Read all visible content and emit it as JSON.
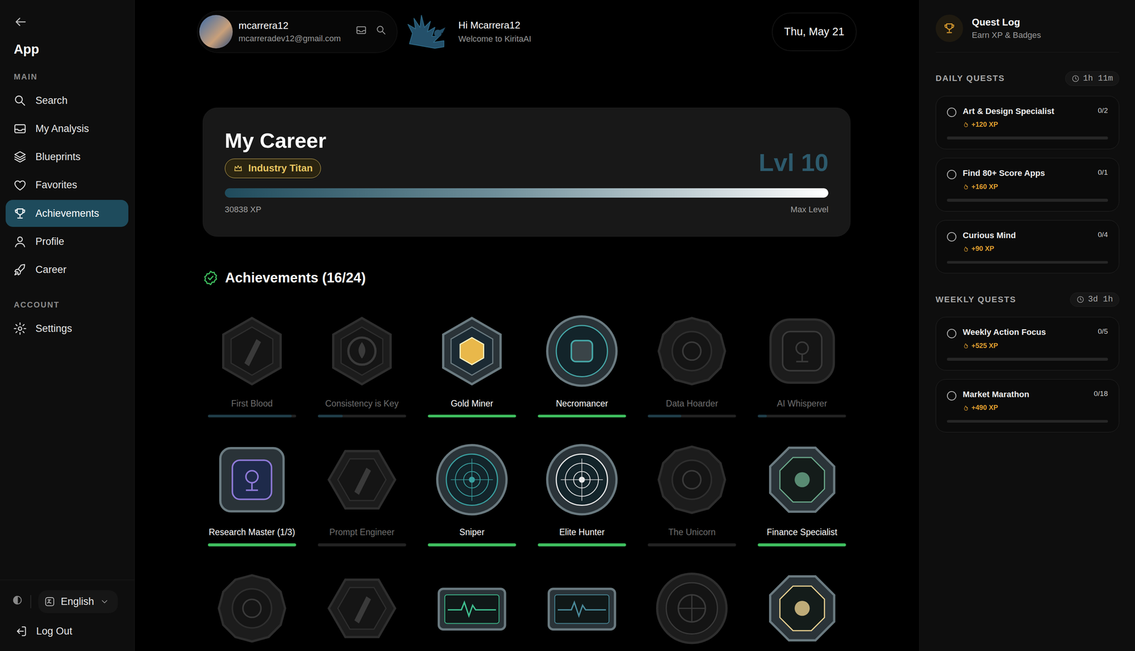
{
  "sidebar": {
    "title": "App",
    "sections": [
      {
        "heading": "MAIN",
        "items": [
          {
            "label": "Search",
            "selected": false
          },
          {
            "label": "My Analysis",
            "selected": false
          },
          {
            "label": "Blueprints",
            "selected": false
          },
          {
            "label": "Favorites",
            "selected": false
          },
          {
            "label": "Achievements",
            "selected": true
          },
          {
            "label": "Profile",
            "selected": false
          },
          {
            "label": "Career",
            "selected": false
          }
        ]
      },
      {
        "heading": "ACCOUNT",
        "items": [
          {
            "label": "Settings",
            "selected": false
          }
        ]
      }
    ],
    "language": "English",
    "logout": "Log Out"
  },
  "header": {
    "user": {
      "name": "mcarrera12",
      "email": "mcarreradev12@gmail.com"
    },
    "greeting": "Hi Mcarrera12",
    "welcome": "Welcome to KiritaAI",
    "date": "Thu, May 21"
  },
  "career": {
    "title": "My Career",
    "rank": "Industry Titan",
    "level_label": "Lvl 10",
    "level": 1,
    "xp": "30838 XP",
    "status": "Max Level"
  },
  "achievements": {
    "title": "Achievements (16/24)",
    "items": [
      {
        "name": "First Blood",
        "unlocked": false,
        "level": 0.95
      },
      {
        "name": "Consistency is Key",
        "unlocked": false,
        "level": 0.28
      },
      {
        "name": "Gold Miner",
        "unlocked": true,
        "level": 1
      },
      {
        "name": "Necromancer",
        "unlocked": true,
        "level": 1
      },
      {
        "name": "Data Hoarder",
        "unlocked": false,
        "level": 0.38
      },
      {
        "name": "AI Whisperer",
        "unlocked": false,
        "level": 0.1
      },
      {
        "name": "Research Master (1/3)",
        "unlocked": true,
        "level": 1
      },
      {
        "name": "Prompt Engineer",
        "unlocked": false,
        "level": 0
      },
      {
        "name": "Sniper",
        "unlocked": true,
        "level": 1
      },
      {
        "name": "Elite Hunter",
        "unlocked": true,
        "level": 1
      },
      {
        "name": "The Unicorn",
        "unlocked": false,
        "level": 0
      },
      {
        "name": "Finance Specialist",
        "unlocked": true,
        "level": 1
      },
      {
        "unlocked": false
      },
      {
        "unlocked": false
      },
      {
        "unlocked": true
      },
      {
        "unlocked": true
      },
      {
        "unlocked": false
      },
      {
        "unlocked": true
      }
    ]
  },
  "quest_log": {
    "title": "Quest Log",
    "subtitle": "Earn XP & Badges",
    "groups": [
      {
        "heading": "DAILY QUESTS",
        "timer": "1h 11m",
        "quests": [
          {
            "title": "Art & Design Specialist",
            "xp": "+120 XP",
            "progress": "0/2",
            "done": false,
            "level": 0
          },
          {
            "title": "Find 80+ Score Apps",
            "xp": "+160 XP",
            "progress": "0/1",
            "done": false,
            "level": 0
          },
          {
            "title": "Curious Mind",
            "xp": "+90 XP",
            "progress": "0/4",
            "done": false,
            "level": 0
          }
        ]
      },
      {
        "heading": "WEEKLY QUESTS",
        "timer": "3d 1h",
        "quests": [
          {
            "title": "Weekly Action Focus",
            "xp": "+525 XP",
            "progress": "0/5",
            "done": false,
            "level": 0
          },
          {
            "title": "Market Marathon",
            "xp": "+490 XP",
            "progress": "0/18",
            "done": false,
            "level": 0
          }
        ]
      }
    ]
  }
}
